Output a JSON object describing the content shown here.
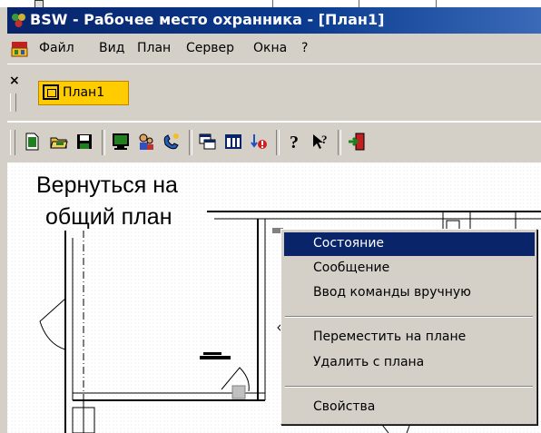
{
  "window": {
    "title": "BSW - Рабочее место охранника - [План1]",
    "title_color": "#ffffff",
    "title_bg": "#0a246a"
  },
  "menubar": {
    "icon": "plan-app-icon",
    "items": [
      "Файл",
      "Вид",
      "План",
      "Сервер",
      "Окна",
      "?"
    ]
  },
  "tabs": {
    "close_glyph": "×",
    "items": [
      {
        "label": "План1",
        "active": true
      }
    ]
  },
  "toolbar": {
    "buttons": [
      "new-icon",
      "open-icon",
      "save-icon",
      "monitor-icon",
      "users-icon",
      "phone-icon",
      "windows-icon",
      "columns-icon",
      "alarm-icon",
      "help-icon",
      "context-help-icon",
      "exit-icon"
    ]
  },
  "plan": {
    "label_line1": "Вернуться на",
    "label_line2": "общий план"
  },
  "context_menu": {
    "groups": [
      [
        {
          "label": "Состояние",
          "selected": true
        },
        {
          "label": "Сообщение"
        },
        {
          "label": "Ввод команды вручную"
        }
      ],
      [
        {
          "label": "Переместить на плане"
        },
        {
          "label": "Удалить с плана"
        }
      ],
      [
        {
          "label": "Свойства"
        }
      ]
    ]
  },
  "colors": {
    "menu_face": "#d4d0c8",
    "selection": "#0a246a",
    "tab_accent": "#ffcc00"
  }
}
